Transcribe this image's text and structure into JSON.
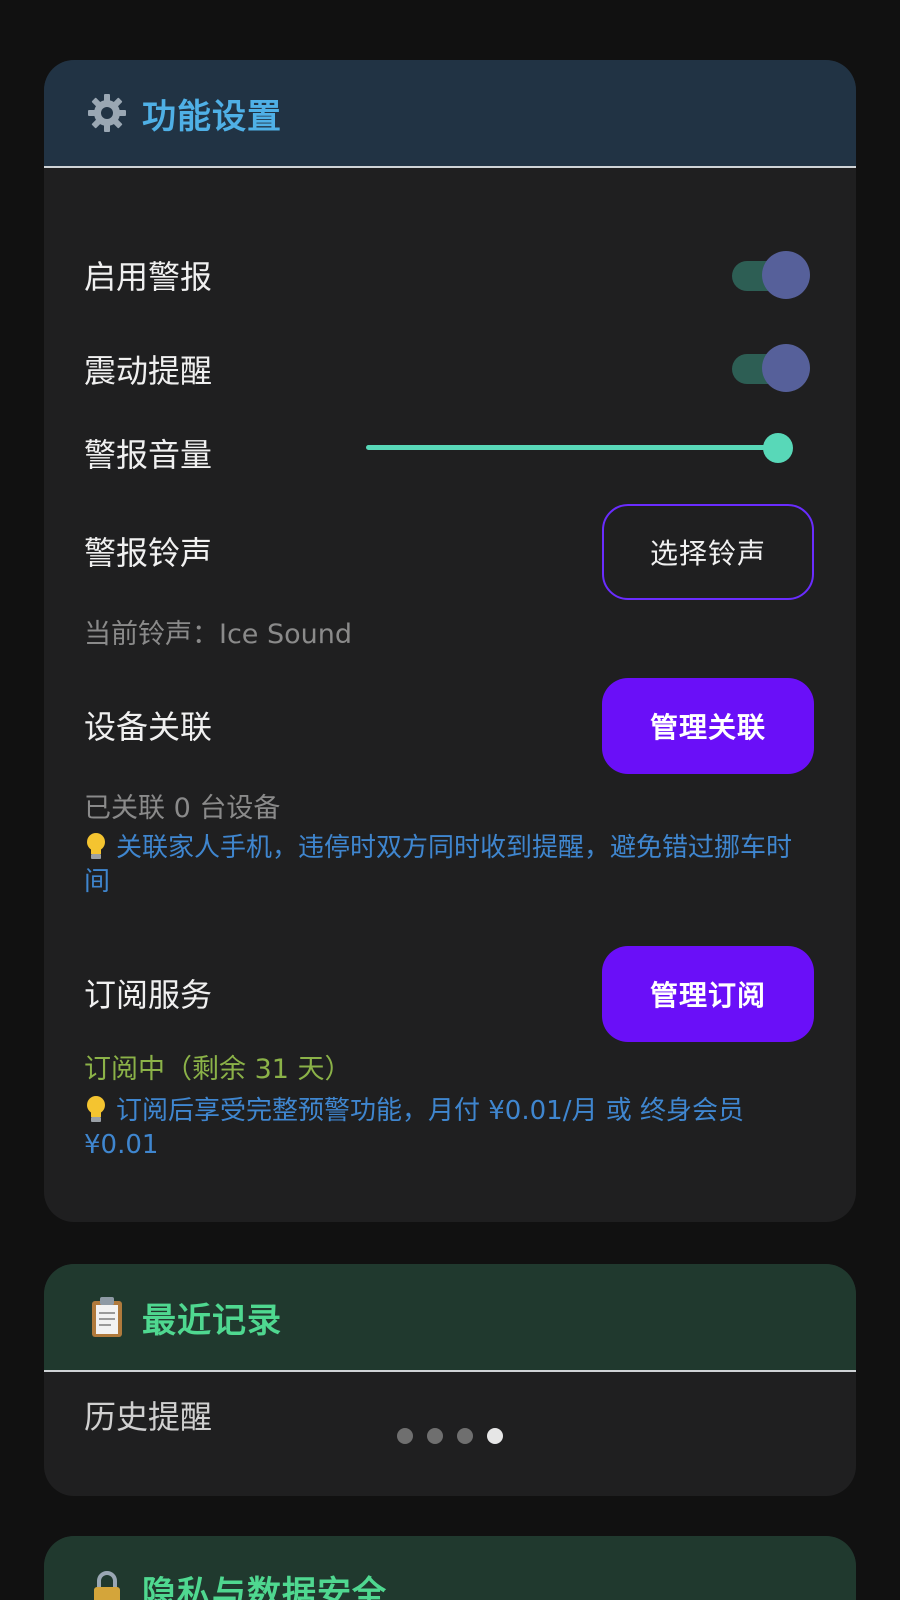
{
  "settings": {
    "title": "功能设置",
    "icon": "gear-icon",
    "enable_alarm": {
      "label": "启用警报",
      "on": true
    },
    "vibration": {
      "label": "震动提醒",
      "on": true
    },
    "volume": {
      "label": "警报音量",
      "level": 1.0
    },
    "ringtone": {
      "label": "警报铃声",
      "button": "选择铃声",
      "current": "当前铃声：Ice Sound"
    },
    "device_link": {
      "label": "设备关联",
      "button": "管理关联",
      "status": "已关联 0 台设备",
      "tip": "关联家人手机，违停时双方同时收到提醒，避免错过挪车时间"
    },
    "subscription": {
      "label": "订阅服务",
      "button": "管理订阅",
      "status": "订阅中（剩余 31 天）",
      "tip": "订阅后享受完整预警功能，月付 ¥0.01/月 或 终身会员 ¥0.01"
    }
  },
  "records": {
    "title": "最近记录",
    "icon": "clipboard-icon",
    "history_label": "历史提醒",
    "pager": {
      "count": 4,
      "active": 4
    }
  },
  "privacy": {
    "title": "隐私与数据安全",
    "icon": "lock-icon"
  },
  "colors": {
    "background": "#111111",
    "card": "#1f1f20",
    "accent_purple": "#6a0ff8",
    "slider_teal": "#58d8b8",
    "tip_blue": "#3f86cf",
    "status_green": "#8bb248"
  }
}
